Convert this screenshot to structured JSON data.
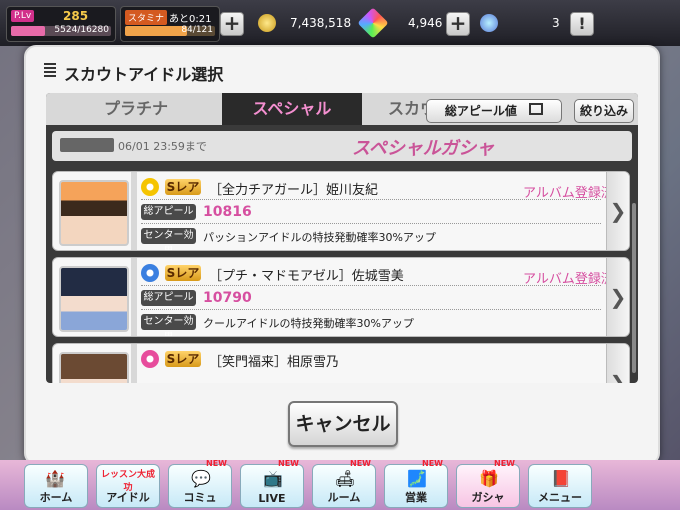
{
  "status": {
    "plv_label": "P.Lv",
    "plv": "285",
    "exp": "5524/16280",
    "stamina_label": "スタミナ",
    "stamina_time": "あと0:21",
    "stamina": "84/121",
    "money": "7,438,518",
    "jewels": "4,946",
    "items": "3"
  },
  "modal": {
    "title": "スカウトアイドル選択",
    "tabs": [
      "プラチナ",
      "スペシャル",
      "スカウ"
    ],
    "sort_label": "総アピール値",
    "filter_label": "絞り込み",
    "banner_date_label": "06/01 23:59まで",
    "banner_title": "スペシャルガシャ",
    "cancel_label": "キャンセル"
  },
  "cards": [
    {
      "rarity": "Sレア",
      "name": "［全力チアガール］姫川友紀",
      "album": "アルバム登録済",
      "appeal_label": "総アピール",
      "appeal": "10816",
      "skill_label": "センター効果",
      "skill": "パッションアイドルの特技発動確率30%アップ",
      "attr_color": "#f5c400"
    },
    {
      "rarity": "Sレア",
      "name": "［プチ・マドモアゼル］佐城雪美",
      "album": "アルバム登録済",
      "appeal_label": "総アピール",
      "appeal": "10790",
      "skill_label": "センター効果",
      "skill": "クールアイドルの特技発動確率30%アップ",
      "attr_color": "#3a7fe0"
    },
    {
      "rarity": "Sレア",
      "name": "［笑門福来］相原雪乃",
      "attr_color": "#e74c9c"
    }
  ],
  "nav": {
    "home": "ホーム",
    "idol": "アイドル",
    "idol_banner": "レッスン大成功",
    "commu": "コミュ",
    "live": "LIVE",
    "room": "ルーム",
    "business": "営業",
    "gacha": "ガシャ",
    "menu": "メニュー",
    "new_badge": "NEW"
  }
}
